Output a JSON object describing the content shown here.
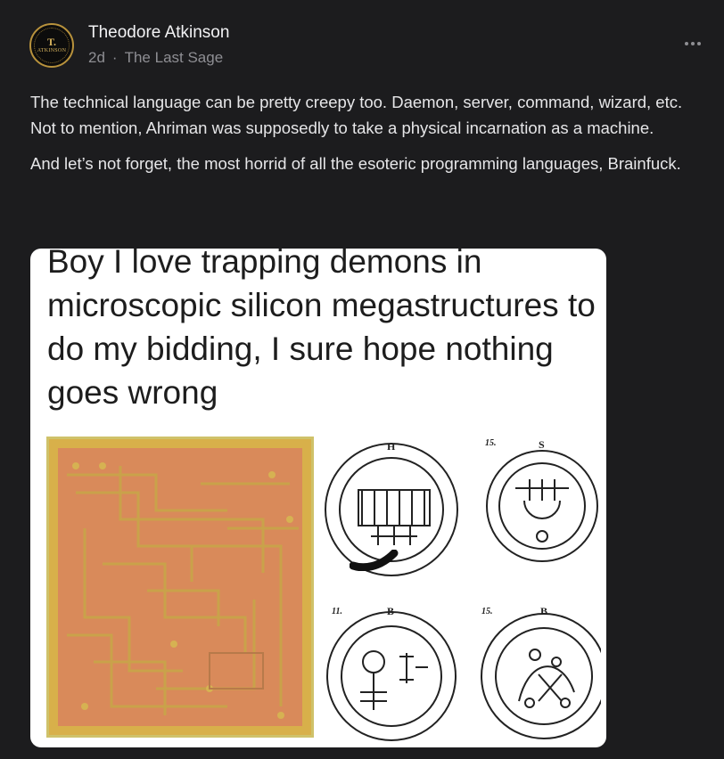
{
  "author": {
    "name": "Theodore Atkinson",
    "avatar_initial": "T.",
    "avatar_text": "ATKINSON",
    "time": "2d",
    "separator": "·",
    "publication": "The Last Sage"
  },
  "post": {
    "paragraphs": [
      "The technical language can be pretty creepy too. Daemon, server, command, wizard, etc. Not to mention, Ahriman was supposedly to take a physical incarnation as a machine.",
      "And let’s not forget, the most horrid of all the esoteric programming languages, Brainfuck."
    ]
  },
  "meme": {
    "caption": "Boy I love trapping demons in microscopic silicon megastructures to do my bidding, I sure hope nothing goes wrong",
    "seal_numbers": [
      "15.",
      "11.",
      "15."
    ],
    "seal_letters": {
      "top_left": "H",
      "top_right": "S",
      "bottom_left": "B",
      "bottom_right": "B"
    }
  },
  "colors": {
    "background": "#1c1c1e",
    "text": "#e6e6e8",
    "muted": "#8e8e93",
    "avatar_gold": "#b8923c",
    "pcb_gold": "#d8b04a",
    "pcb_copper": "#d98a5a"
  },
  "icons": [
    "more-options-icon"
  ]
}
